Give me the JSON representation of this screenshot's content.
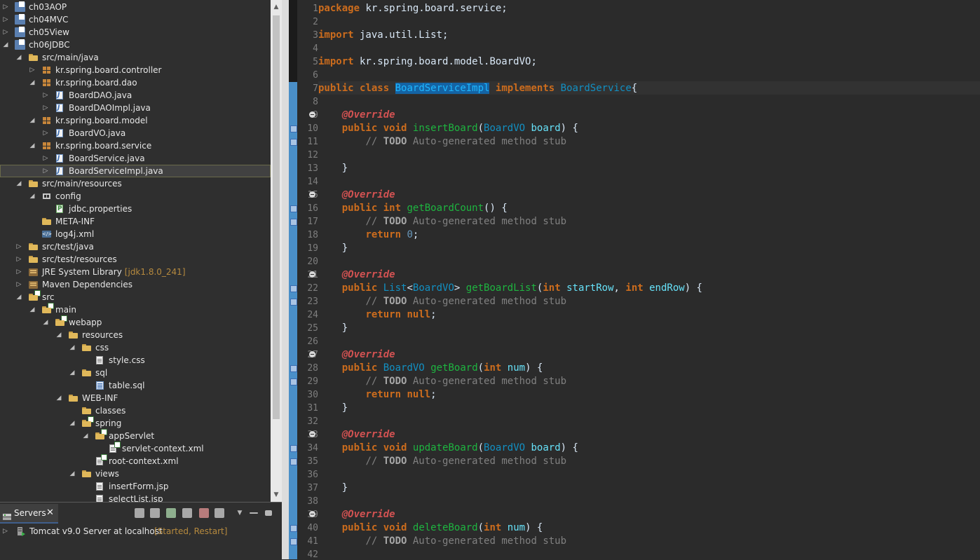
{
  "explorer": {
    "items": [
      {
        "label": "ch03AOP",
        "level": 0,
        "icon": "project-icon",
        "expand": "collapsed"
      },
      {
        "label": "ch04MVC",
        "level": 0,
        "icon": "project-icon",
        "expand": "collapsed"
      },
      {
        "label": "ch05View",
        "level": 0,
        "icon": "project-icon",
        "expand": "collapsed"
      },
      {
        "label": "ch06JDBC",
        "level": 0,
        "icon": "project-icon",
        "expand": "expanded"
      },
      {
        "label": "src/main/java",
        "level": 1,
        "icon": "source-folder-icon",
        "expand": "expanded"
      },
      {
        "label": "kr.spring.board.controller",
        "level": 2,
        "icon": "package-icon",
        "expand": "collapsed"
      },
      {
        "label": "kr.spring.board.dao",
        "level": 2,
        "icon": "package-icon",
        "expand": "expanded"
      },
      {
        "label": "BoardDAO.java",
        "level": 3,
        "icon": "java-interface-icon",
        "expand": "collapsed"
      },
      {
        "label": "BoardDAOImpl.java",
        "level": 3,
        "icon": "java-file-icon",
        "expand": "collapsed"
      },
      {
        "label": "kr.spring.board.model",
        "level": 2,
        "icon": "package-icon",
        "expand": "expanded"
      },
      {
        "label": "BoardVO.java",
        "level": 3,
        "icon": "java-file-icon",
        "expand": "collapsed"
      },
      {
        "label": "kr.spring.board.service",
        "level": 2,
        "icon": "package-icon",
        "expand": "expanded"
      },
      {
        "label": "BoardService.java",
        "level": 3,
        "icon": "java-interface-icon",
        "expand": "collapsed"
      },
      {
        "label": "BoardServiceImpl.java",
        "level": 3,
        "icon": "java-file-icon",
        "expand": "collapsed",
        "selected": true
      },
      {
        "label": "src/main/resources",
        "level": 1,
        "icon": "source-folder-icon",
        "expand": "expanded"
      },
      {
        "label": "config",
        "level": 2,
        "icon": "config-package-icon",
        "expand": "expanded"
      },
      {
        "label": "jdbc.properties",
        "level": 3,
        "icon": "properties-file-icon",
        "expand": "none"
      },
      {
        "label": "META-INF",
        "level": 2,
        "icon": "folder-icon",
        "expand": "none"
      },
      {
        "label": "log4j.xml",
        "level": 2,
        "icon": "xml-file-icon",
        "expand": "none"
      },
      {
        "label": "src/test/java",
        "level": 1,
        "icon": "source-folder-icon",
        "expand": "collapsed"
      },
      {
        "label": "src/test/resources",
        "level": 1,
        "icon": "source-folder-icon",
        "expand": "collapsed"
      },
      {
        "label": "JRE System Library",
        "level": 1,
        "icon": "library-icon",
        "expand": "collapsed",
        "decoration": "[jdk1.8.0_241]"
      },
      {
        "label": "Maven Dependencies",
        "level": 1,
        "icon": "library-icon",
        "expand": "collapsed"
      },
      {
        "label": "src",
        "level": 1,
        "icon": "spring-folder-icon",
        "expand": "expanded"
      },
      {
        "label": "main",
        "level": 2,
        "icon": "spring-folder-icon",
        "expand": "expanded"
      },
      {
        "label": "webapp",
        "level": 3,
        "icon": "spring-folder-icon",
        "expand": "expanded"
      },
      {
        "label": "resources",
        "level": 4,
        "icon": "folder-icon",
        "expand": "expanded"
      },
      {
        "label": "css",
        "level": 5,
        "icon": "folder-icon",
        "expand": "expanded"
      },
      {
        "label": "style.css",
        "level": 6,
        "icon": "css-file-icon",
        "expand": "none"
      },
      {
        "label": "sql",
        "level": 5,
        "icon": "folder-icon",
        "expand": "expanded"
      },
      {
        "label": "table.sql",
        "level": 6,
        "icon": "sql-file-icon",
        "expand": "none"
      },
      {
        "label": "WEB-INF",
        "level": 4,
        "icon": "folder-icon",
        "expand": "expanded"
      },
      {
        "label": "classes",
        "level": 5,
        "icon": "folder-icon",
        "expand": "none"
      },
      {
        "label": "spring",
        "level": 5,
        "icon": "spring-folder-icon",
        "expand": "expanded"
      },
      {
        "label": "appServlet",
        "level": 6,
        "icon": "spring-folder-icon",
        "expand": "expanded"
      },
      {
        "label": "servlet-context.xml",
        "level": 7,
        "icon": "spring-xml-icon",
        "expand": "none"
      },
      {
        "label": "root-context.xml",
        "level": 6,
        "icon": "spring-xml-icon",
        "expand": "none"
      },
      {
        "label": "views",
        "level": 5,
        "icon": "folder-icon",
        "expand": "expanded"
      },
      {
        "label": "insertForm.jsp",
        "level": 6,
        "icon": "jsp-file-icon",
        "expand": "none"
      },
      {
        "label": "selectList.jsp",
        "level": 6,
        "icon": "jsp-file-icon",
        "expand": "none"
      }
    ]
  },
  "servers": {
    "tab_label": "Servers",
    "close_glyph": "✕",
    "server_name": "Tomcat v9.0 Server at localhost",
    "server_status": "[Started, Restart]"
  },
  "editor": {
    "line_numbers": [
      "1",
      "2",
      "3",
      "4",
      "5",
      "6",
      "7",
      "8",
      "9",
      "10",
      "11",
      "12",
      "13",
      "14",
      "15",
      "16",
      "17",
      "18",
      "19",
      "20",
      "21",
      "22",
      "23",
      "24",
      "25",
      "26",
      "27",
      "28",
      "29",
      "30",
      "31",
      "32",
      "33",
      "34",
      "35",
      "36",
      "37",
      "38",
      "39",
      "40",
      "41",
      "42"
    ],
    "lines": [
      [
        [
          "kw",
          "package"
        ],
        [
          "p",
          " kr.spring.board.service;"
        ]
      ],
      [],
      [
        [
          "kw",
          "import"
        ],
        [
          "p",
          " java.util.List;"
        ]
      ],
      [],
      [
        [
          "kw",
          "import"
        ],
        [
          "p",
          " kr.spring.board.model.BoardVO;"
        ]
      ],
      [],
      [
        [
          "kw",
          "public"
        ],
        [
          "p",
          " "
        ],
        [
          "kw",
          "class"
        ],
        [
          "p",
          " "
        ],
        [
          "sel",
          "BoardServiceImpl"
        ],
        [
          "p",
          " "
        ],
        [
          "kw",
          "implements"
        ],
        [
          "p",
          " "
        ],
        [
          "ty",
          "BoardService"
        ],
        [
          "p",
          "{"
        ]
      ],
      [],
      [
        [
          "p",
          "    "
        ],
        [
          "ann",
          "@Override"
        ]
      ],
      [
        [
          "p",
          "    "
        ],
        [
          "kw",
          "public"
        ],
        [
          "p",
          " "
        ],
        [
          "kw",
          "void"
        ],
        [
          "p",
          " "
        ],
        [
          "md",
          "insertBoard"
        ],
        [
          "p",
          "("
        ],
        [
          "ty",
          "BoardVO"
        ],
        [
          "p",
          " "
        ],
        [
          "pv",
          "board"
        ],
        [
          "p",
          ") {"
        ]
      ],
      [
        [
          "p",
          "        "
        ],
        [
          "cm",
          "// "
        ],
        [
          "td",
          "TODO"
        ],
        [
          "cm",
          " Auto-generated method stub"
        ]
      ],
      [],
      [
        [
          "p",
          "    }"
        ]
      ],
      [],
      [
        [
          "p",
          "    "
        ],
        [
          "ann",
          "@Override"
        ]
      ],
      [
        [
          "p",
          "    "
        ],
        [
          "kw",
          "public"
        ],
        [
          "p",
          " "
        ],
        [
          "kw",
          "int"
        ],
        [
          "p",
          " "
        ],
        [
          "md",
          "getBoardCount"
        ],
        [
          "p",
          "() {"
        ]
      ],
      [
        [
          "p",
          "        "
        ],
        [
          "cm",
          "// "
        ],
        [
          "td",
          "TODO"
        ],
        [
          "cm",
          " Auto-generated method stub"
        ]
      ],
      [
        [
          "p",
          "        "
        ],
        [
          "kw",
          "return"
        ],
        [
          "p",
          " "
        ],
        [
          "num",
          "0"
        ],
        [
          "p",
          ";"
        ]
      ],
      [
        [
          "p",
          "    }"
        ]
      ],
      [],
      [
        [
          "p",
          "    "
        ],
        [
          "ann",
          "@Override"
        ]
      ],
      [
        [
          "p",
          "    "
        ],
        [
          "kw",
          "public"
        ],
        [
          "p",
          " "
        ],
        [
          "ty",
          "List"
        ],
        [
          "p",
          "<"
        ],
        [
          "ty",
          "BoardVO"
        ],
        [
          "p",
          "> "
        ],
        [
          "md",
          "getBoardList"
        ],
        [
          "p",
          "("
        ],
        [
          "kw",
          "int"
        ],
        [
          "p",
          " "
        ],
        [
          "pv",
          "startRow"
        ],
        [
          "p",
          ", "
        ],
        [
          "kw",
          "int"
        ],
        [
          "p",
          " "
        ],
        [
          "pv",
          "endRow"
        ],
        [
          "p",
          ") {"
        ]
      ],
      [
        [
          "p",
          "        "
        ],
        [
          "cm",
          "// "
        ],
        [
          "td",
          "TODO"
        ],
        [
          "cm",
          " Auto-generated method stub"
        ]
      ],
      [
        [
          "p",
          "        "
        ],
        [
          "kw",
          "return"
        ],
        [
          "p",
          " "
        ],
        [
          "kw",
          "null"
        ],
        [
          "p",
          ";"
        ]
      ],
      [
        [
          "p",
          "    }"
        ]
      ],
      [],
      [
        [
          "p",
          "    "
        ],
        [
          "ann",
          "@Override"
        ]
      ],
      [
        [
          "p",
          "    "
        ],
        [
          "kw",
          "public"
        ],
        [
          "p",
          " "
        ],
        [
          "ty",
          "BoardVO"
        ],
        [
          "p",
          " "
        ],
        [
          "md",
          "getBoard"
        ],
        [
          "p",
          "("
        ],
        [
          "kw",
          "int"
        ],
        [
          "p",
          " "
        ],
        [
          "pv",
          "num"
        ],
        [
          "p",
          ") {"
        ]
      ],
      [
        [
          "p",
          "        "
        ],
        [
          "cm",
          "// "
        ],
        [
          "td",
          "TODO"
        ],
        [
          "cm",
          " Auto-generated method stub"
        ]
      ],
      [
        [
          "p",
          "        "
        ],
        [
          "kw",
          "return"
        ],
        [
          "p",
          " "
        ],
        [
          "kw",
          "null"
        ],
        [
          "p",
          ";"
        ]
      ],
      [
        [
          "p",
          "    }"
        ]
      ],
      [],
      [
        [
          "p",
          "    "
        ],
        [
          "ann",
          "@Override"
        ]
      ],
      [
        [
          "p",
          "    "
        ],
        [
          "kw",
          "public"
        ],
        [
          "p",
          " "
        ],
        [
          "kw",
          "void"
        ],
        [
          "p",
          " "
        ],
        [
          "md",
          "updateBoard"
        ],
        [
          "p",
          "("
        ],
        [
          "ty",
          "BoardVO"
        ],
        [
          "p",
          " "
        ],
        [
          "pv",
          "board"
        ],
        [
          "p",
          ") {"
        ]
      ],
      [
        [
          "p",
          "        "
        ],
        [
          "cm",
          "// "
        ],
        [
          "td",
          "TODO"
        ],
        [
          "cm",
          " Auto-generated method stub"
        ]
      ],
      [],
      [
        [
          "p",
          "    }"
        ]
      ],
      [],
      [
        [
          "p",
          "    "
        ],
        [
          "ann",
          "@Override"
        ]
      ],
      [
        [
          "p",
          "    "
        ],
        [
          "kw",
          "public"
        ],
        [
          "p",
          " "
        ],
        [
          "kw",
          "void"
        ],
        [
          "p",
          " "
        ],
        [
          "md",
          "deleteBoard"
        ],
        [
          "p",
          "("
        ],
        [
          "kw",
          "int"
        ],
        [
          "p",
          " "
        ],
        [
          "pv",
          "num"
        ],
        [
          "p",
          ") {"
        ]
      ],
      [
        [
          "p",
          "        "
        ],
        [
          "cm",
          "// "
        ],
        [
          "td",
          "TODO"
        ],
        [
          "cm",
          " Auto-generated method stub"
        ]
      ],
      []
    ],
    "fold_lines": [
      9,
      15,
      21,
      27,
      33,
      39
    ],
    "override_marker_lines": [
      10,
      11,
      16,
      17,
      22,
      23,
      28,
      29,
      34,
      35,
      40,
      41
    ]
  }
}
